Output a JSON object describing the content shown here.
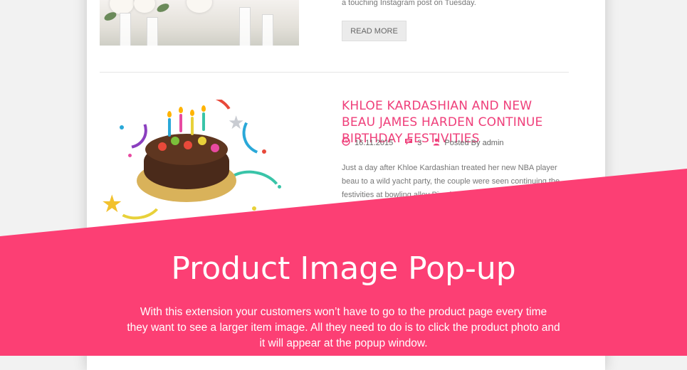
{
  "previous_post": {
    "excerpt_tail": "a touching Instagram post on Tuesday.",
    "read_more_label": "READ MORE"
  },
  "post": {
    "title": "KHLOE KARDASHIAN AND NEW BEAU JAMES HARDEN CONTINUE BIRTHDAY FESTIVITIES",
    "date": "16.11.2015",
    "comments": "3",
    "author": "Posted By admin",
    "excerpt_lines": [
      "Just a day after Khloe Kardashian treated her new NBA player",
      "beau to a wild yacht party, the couple were seen continuing the",
      "festivities at bowling alley Pina in Studio City, California"
    ]
  },
  "banner": {
    "title": "Product Image Pop-up",
    "description_lines": [
      "With this extension your customers won’t have to go to the product page every time",
      "they want to see a larger item image. All they need to do is to click the product photo and",
      "it will appear at the popup window."
    ]
  },
  "icons": [
    "clock-icon",
    "comment-icon",
    "user-icon"
  ],
  "colors": {
    "accent": "#ef3f7a",
    "banner": "#fc3f74",
    "text": "#777777"
  }
}
